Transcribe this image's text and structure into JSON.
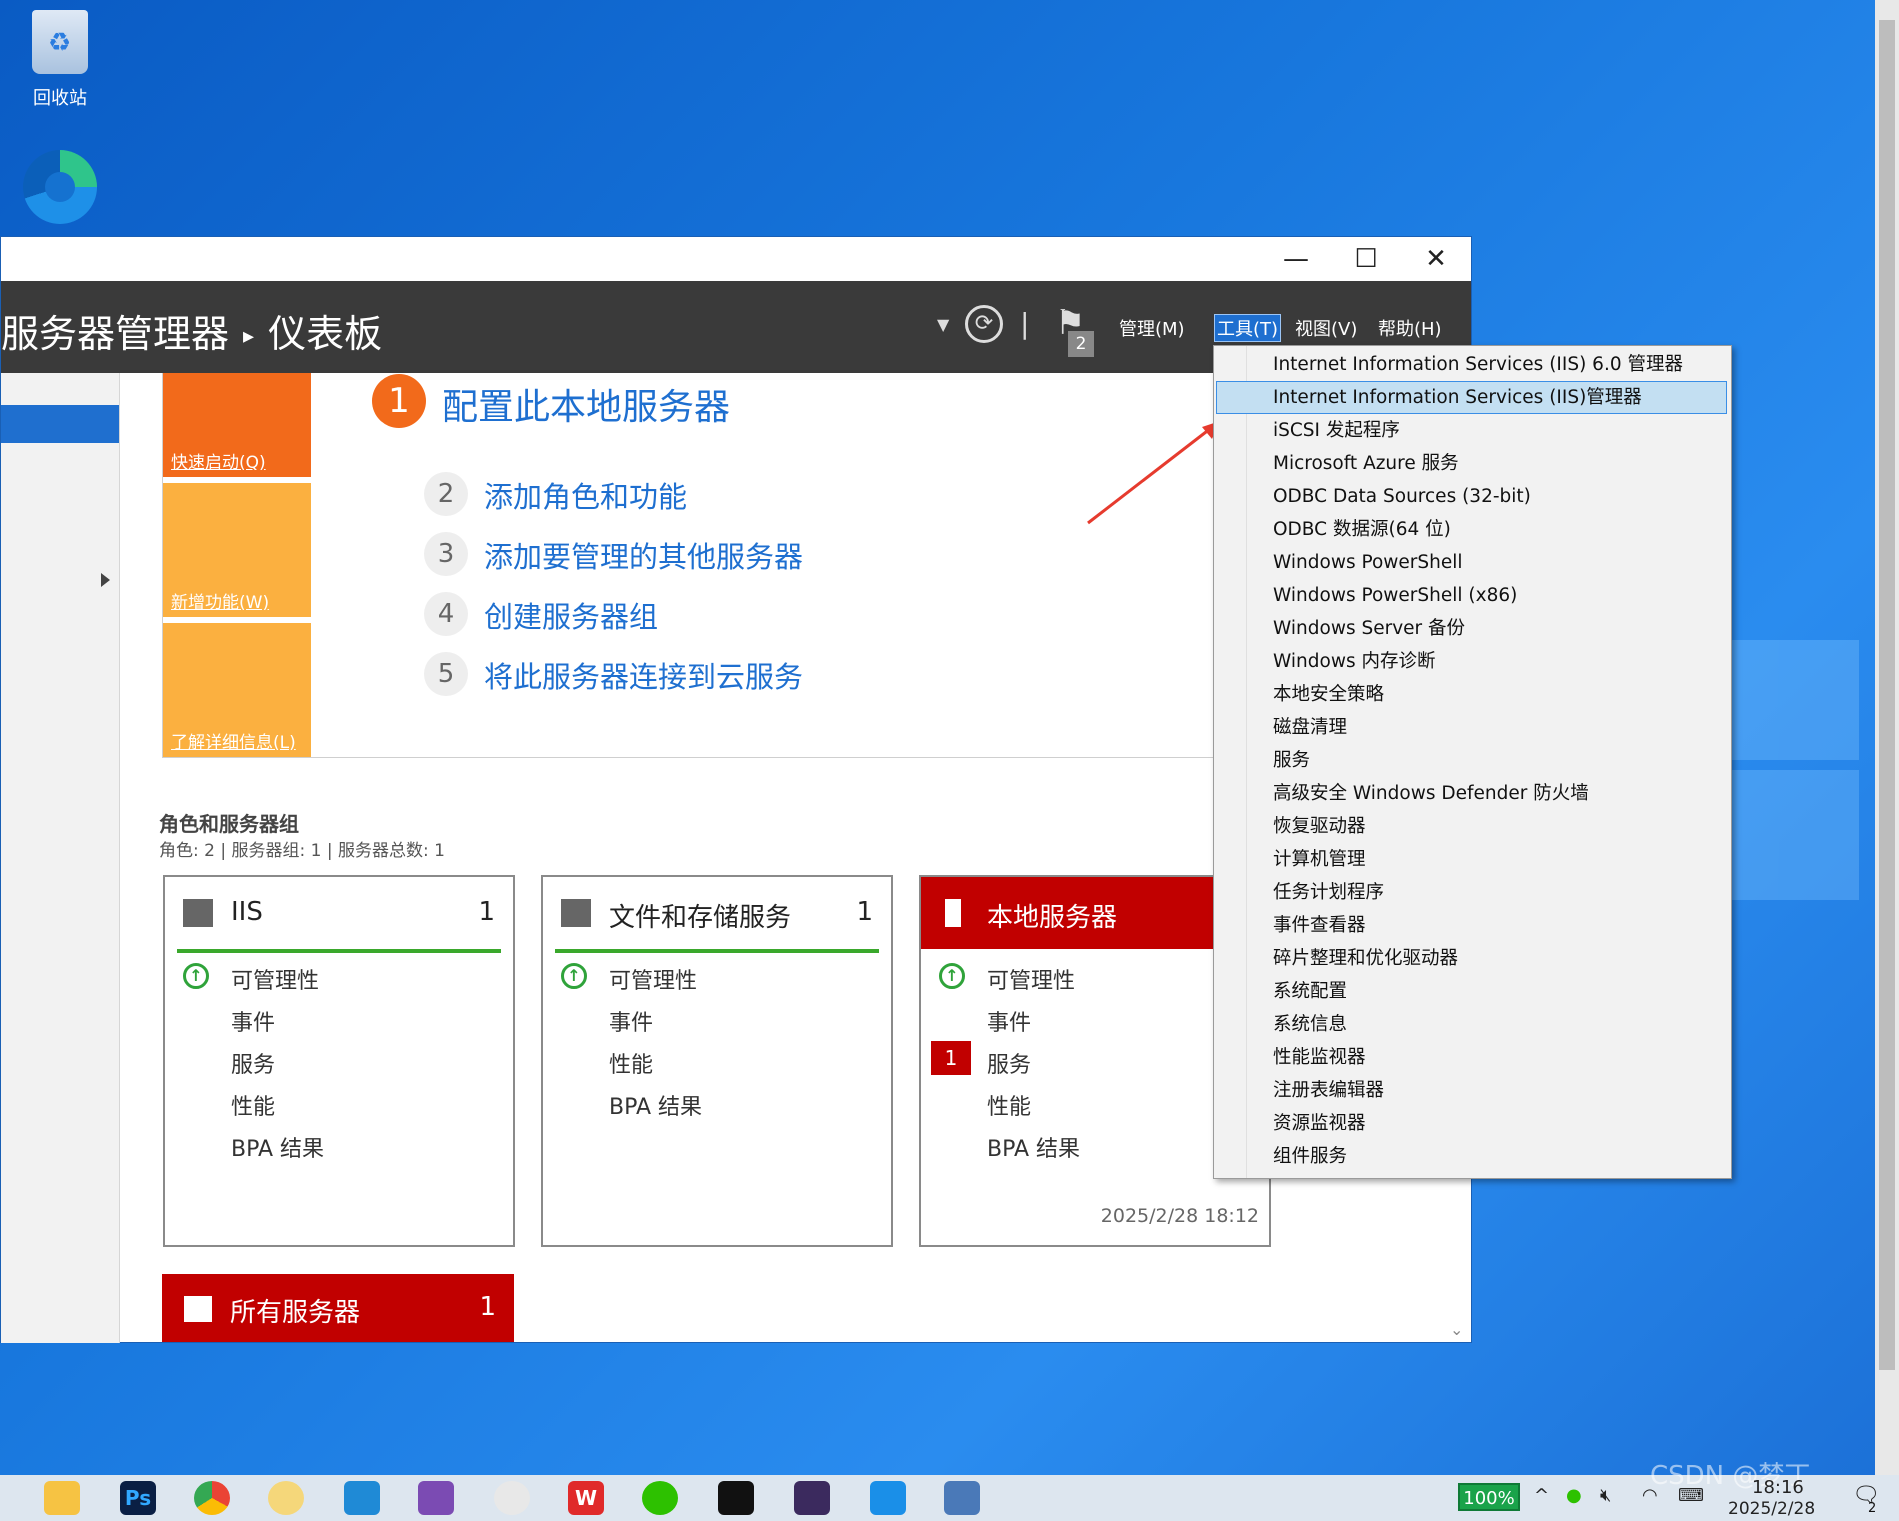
{
  "desktop": {
    "recycle_bin_label": "回收站"
  },
  "window": {
    "title_controls": {
      "minimize": "—",
      "maximize": "☐",
      "close": "✕"
    },
    "breadcrumb": {
      "app": "服务器管理器",
      "page": "仪表板"
    },
    "menus": {
      "manage": "管理(M)",
      "tools": "工具(T)",
      "view": "视图(V)",
      "help": "帮助(H)"
    },
    "notification_count": "2"
  },
  "quick_start": {
    "tiles": [
      "快速启动(Q)",
      "新增功能(W)",
      "了解详细信息(L)"
    ],
    "colors": [
      "#f26a1b",
      "#fbb040",
      "#fbb040"
    ]
  },
  "welcome": {
    "step1": {
      "num": "1",
      "label": "配置此本地服务器"
    },
    "steps": [
      {
        "num": "2",
        "label": "添加角色和功能"
      },
      {
        "num": "3",
        "label": "添加要管理的其他服务器"
      },
      {
        "num": "4",
        "label": "创建服务器组"
      },
      {
        "num": "5",
        "label": "将此服务器连接到云服务"
      }
    ]
  },
  "roles_section": {
    "title": "角色和服务器组",
    "subtitle": "角色: 2 | 服务器组: 1 | 服务器总数: 1"
  },
  "cards": [
    {
      "title": "IIS",
      "count": "1",
      "rows": [
        "可管理性",
        "事件",
        "服务",
        "性能",
        "BPA 结果"
      ]
    },
    {
      "title": "文件和存储服务",
      "count": "1",
      "rows": [
        "可管理性",
        "事件",
        "性能",
        "BPA 结果"
      ]
    },
    {
      "title": "本地服务器",
      "count": "1",
      "rows": [
        "可管理性",
        "事件",
        "服务",
        "性能",
        "BPA 结果"
      ],
      "services_badge": "1",
      "timestamp": "2025/2/28 18:12"
    }
  ],
  "all_servers": {
    "title": "所有服务器",
    "count": "1"
  },
  "tools_menu": {
    "items": [
      "Internet Information Services (IIS) 6.0 管理器",
      "Internet Information Services (IIS)管理器",
      "iSCSI 发起程序",
      "Microsoft Azure 服务",
      "ODBC Data Sources (32-bit)",
      "ODBC 数据源(64 位)",
      "Windows PowerShell",
      "Windows PowerShell (x86)",
      "Windows Server 备份",
      "Windows 内存诊断",
      "本地安全策略",
      "磁盘清理",
      "服务",
      "高级安全 Windows Defender 防火墙",
      "恢复驱动器",
      "计算机管理",
      "任务计划程序",
      "事件查看器",
      "碎片整理和优化驱动器",
      "系统配置",
      "系统信息",
      "性能监视器",
      "注册表编辑器",
      "资源监视器",
      "组件服务"
    ],
    "highlighted_index": 1
  },
  "taskbar": {
    "battery": "100%",
    "time": "18:16",
    "date": "2025/2/28",
    "notification_count": "2",
    "watermark": "CSDN @梦丁"
  }
}
